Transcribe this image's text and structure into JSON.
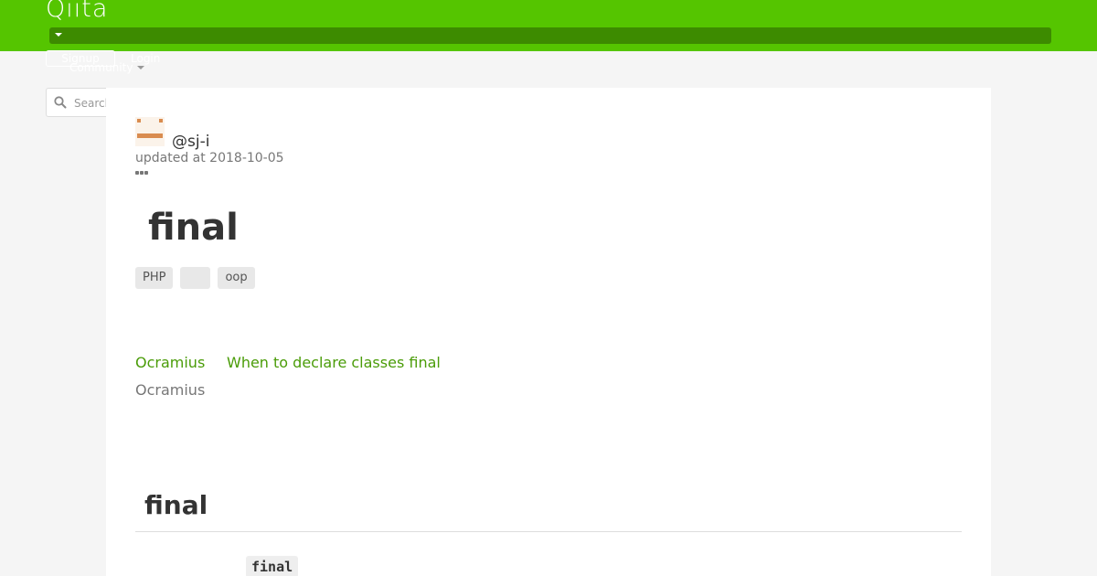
{
  "header": {
    "logo": "Qiita",
    "signup_label": "Signup",
    "login_label": "Login",
    "community_label": "Community"
  },
  "search": {
    "placeholder": "Search"
  },
  "article": {
    "author": "@sj-i",
    "updated_at": "updated at 2018-10-05",
    "title": "final",
    "tags": [
      "PHP",
      "",
      "oop"
    ],
    "reference": {
      "author_link": "Ocramius",
      "title_link": "When to declare classes final",
      "author_text": "Ocramius"
    },
    "section_heading": "final",
    "inline_code": "final"
  },
  "colors": {
    "header_green": "#55c500",
    "link_green": "#4a9c08"
  }
}
